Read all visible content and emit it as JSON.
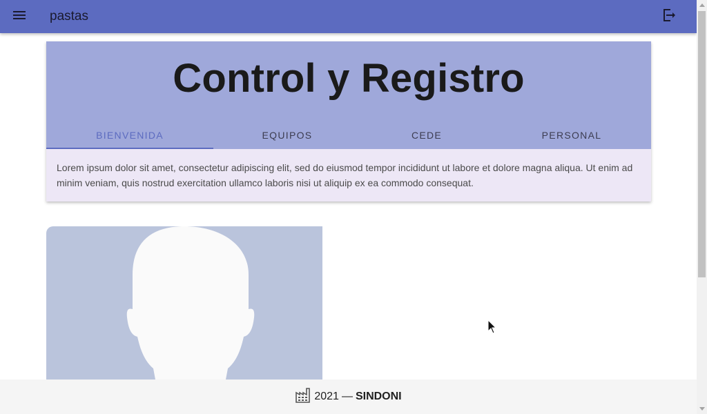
{
  "appbar": {
    "title": "pastas",
    "menu_icon": "menu-icon",
    "logout_icon": "logout-icon",
    "color": "#5c6bc0"
  },
  "card": {
    "title": "Control y Registro",
    "header_color": "#9fa8da",
    "tabs": [
      {
        "label": "BIENVENIDA",
        "active": true
      },
      {
        "label": "EQUIPOS",
        "active": false
      },
      {
        "label": "CEDE",
        "active": false
      },
      {
        "label": "PERSONAL",
        "active": false
      }
    ],
    "body_text": "Lorem ipsum dolor sit amet, consectetur adipiscing elit, sed do eiusmod tempor incididunt ut labore et dolore magna aliqua. Ut enim ad minim veniam, quis nostrud exercitation ullamco laboris nisi ut aliquip ex ea commodo consequat."
  },
  "profile_image": {
    "icon": "user-silhouette"
  },
  "footer": {
    "icon": "factory-icon",
    "year": "2021",
    "separator": "—",
    "brand": "SINDONI"
  }
}
